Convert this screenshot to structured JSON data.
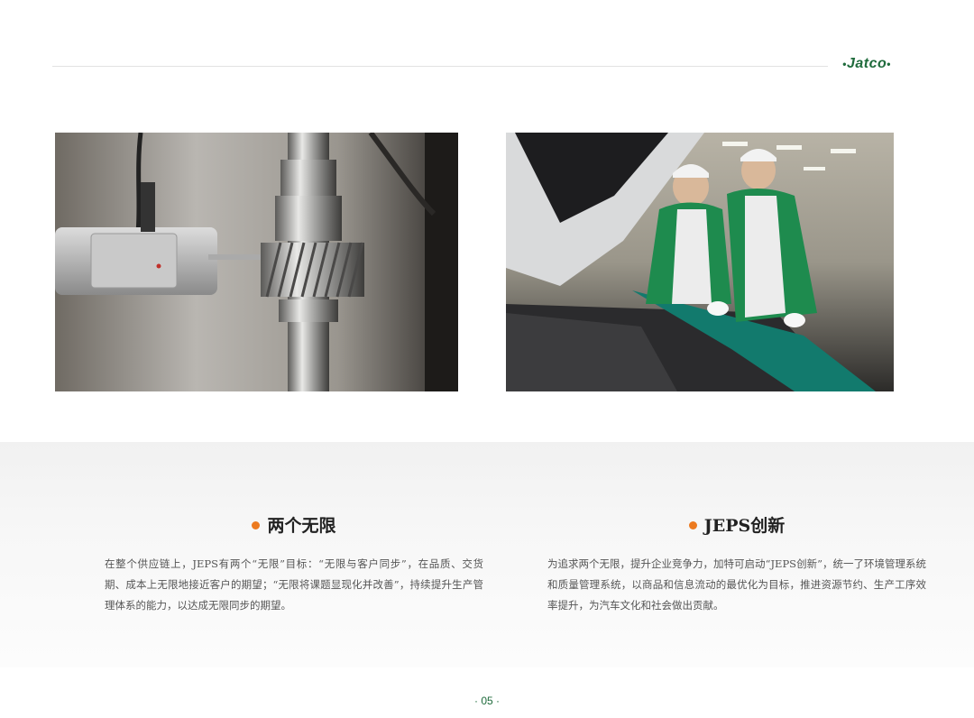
{
  "header": {
    "brand": "Jatco"
  },
  "photos": {
    "left": {
      "subject": "gear-shaft-inspection"
    },
    "right": {
      "subject": "engineers-inspecting-engine"
    }
  },
  "sections": [
    {
      "title": "两个无限",
      "body": "在整个供应链上，JEPS有两个“无限”目标：“无限与客户同步”，在品质、交货期、成本上无限地接近客户的期望；“无限将课题显现化并改善”，持续提升生产管理体系的能力，以达成无限同步的期望。"
    },
    {
      "title": "JEPS创新",
      "body": "为追求两个无限，提升企业竞争力，加特可启动“JEPS创新”，统一了环境管理系统和质量管理系统，以商品和信息流动的最优化为目标，推进资源节约、生产工序效率提升，为汽车文化和社会做出贡献。"
    }
  ],
  "footer": {
    "page": "05"
  },
  "colors": {
    "brand_green": "#1f6b3c",
    "accent_orange": "#ec7a1f"
  }
}
